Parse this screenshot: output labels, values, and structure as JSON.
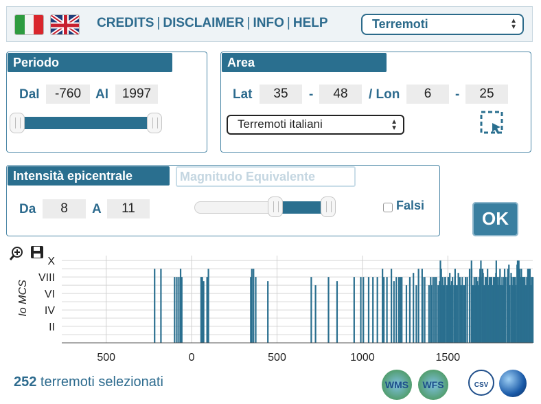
{
  "nav": {
    "flags": [
      "it",
      "en"
    ],
    "links": [
      "CREDITS",
      "DISCLAIMER",
      "INFO",
      "HELP"
    ],
    "layer_select": "Terremoti"
  },
  "periodo": {
    "title": "Periodo",
    "from_label": "Dal",
    "from_value": "-760",
    "to_label": "Al",
    "to_value": "1997"
  },
  "area": {
    "title": "Area",
    "lat_label": "Lat",
    "lat_min": "35",
    "lat_max": "48",
    "lon_label": "/ Lon",
    "lon_min": "6",
    "lon_max": "25",
    "dash": "-",
    "preset": "Terremoti italiani"
  },
  "intensita": {
    "title": "Intensità epicentrale",
    "magnitude_title": "Magnitudo Equivalente",
    "from_label": "Da",
    "from_value": "8",
    "to_label": "A",
    "to_value": "11",
    "slider_from_fraction": 0.58,
    "slider_to_fraction": 1.0,
    "falsi_label": "Falsi",
    "ok_label": "OK"
  },
  "chart_data": {
    "type": "bar",
    "ylabel": "Io MCS",
    "yticks": [
      "II",
      "IV",
      "VI",
      "VIII",
      "X"
    ],
    "ytick_values": [
      3,
      5,
      7,
      9,
      11
    ],
    "xticks": [
      -500,
      0,
      500,
      1000,
      1500
    ],
    "xtick_labels": [
      "500",
      "0",
      "500",
      "1000",
      "1500"
    ],
    "xlim": [
      -760,
      1997
    ],
    "ylim": [
      1,
      11.6
    ],
    "grid": true,
    "color": "#2a6f8f",
    "events": [
      [
        -217,
        10
      ],
      [
        -180,
        10
      ],
      [
        -100,
        9
      ],
      [
        -87,
        9
      ],
      [
        -75,
        9
      ],
      [
        -65,
        10
      ],
      [
        -58,
        9
      ],
      [
        55,
        9
      ],
      [
        62,
        9
      ],
      [
        70,
        8.5
      ],
      [
        90,
        9
      ],
      [
        98,
        10
      ],
      [
        346,
        9
      ],
      [
        352,
        10
      ],
      [
        362,
        10
      ],
      [
        375,
        9
      ],
      [
        446,
        8.5
      ],
      [
        700,
        9
      ],
      [
        725,
        8
      ],
      [
        801,
        9
      ],
      [
        851,
        8.5
      ],
      [
        951,
        9
      ],
      [
        990,
        9
      ],
      [
        1005,
        9
      ],
      [
        1036,
        9
      ],
      [
        1061,
        9
      ],
      [
        1087,
        9
      ],
      [
        1117,
        10
      ],
      [
        1125,
        9
      ],
      [
        1143,
        9
      ],
      [
        1169,
        10
      ],
      [
        1184,
        8.5
      ],
      [
        1198,
        9
      ],
      [
        1213,
        9
      ],
      [
        1222,
        9
      ],
      [
        1230,
        9
      ],
      [
        1257,
        8
      ],
      [
        1277,
        9
      ],
      [
        1298,
        9.5
      ],
      [
        1315,
        8
      ],
      [
        1328,
        10
      ],
      [
        1349,
        10
      ],
      [
        1352,
        9
      ],
      [
        1364,
        9
      ],
      [
        1389,
        8
      ],
      [
        1399,
        9
      ],
      [
        1403,
        8
      ],
      [
        1413,
        9
      ],
      [
        1423,
        9
      ],
      [
        1432,
        9
      ],
      [
        1443,
        8
      ],
      [
        1451,
        8.5
      ],
      [
        1456,
        11
      ],
      [
        1461,
        10
      ],
      [
        1465,
        8
      ],
      [
        1470,
        9
      ],
      [
        1476,
        8
      ],
      [
        1483,
        9
      ],
      [
        1485,
        9
      ],
      [
        1494,
        8
      ],
      [
        1501,
        9
      ],
      [
        1506,
        9
      ],
      [
        1511,
        9.5
      ],
      [
        1517,
        8
      ],
      [
        1522,
        8.5
      ],
      [
        1527,
        9
      ],
      [
        1536,
        8
      ],
      [
        1541,
        9
      ],
      [
        1542,
        10
      ],
      [
        1550,
        8
      ],
      [
        1559,
        8
      ],
      [
        1561,
        9.5
      ],
      [
        1570,
        9
      ],
      [
        1577,
        8
      ],
      [
        1584,
        9
      ],
      [
        1593,
        8
      ],
      [
        1600,
        8
      ],
      [
        1603,
        9
      ],
      [
        1613,
        9
      ],
      [
        1627,
        10
      ],
      [
        1638,
        11
      ],
      [
        1639,
        10
      ],
      [
        1643,
        8
      ],
      [
        1651,
        8
      ],
      [
        1654,
        9
      ],
      [
        1661,
        8
      ],
      [
        1664,
        9
      ],
      [
        1668,
        9
      ],
      [
        1672,
        8.5
      ],
      [
        1679,
        8
      ],
      [
        1683,
        9
      ],
      [
        1688,
        10
      ],
      [
        1693,
        11
      ],
      [
        1694,
        10
      ],
      [
        1702,
        9
      ],
      [
        1703,
        10
      ],
      [
        1706,
        9.5
      ],
      [
        1708,
        8
      ],
      [
        1714,
        8
      ],
      [
        1719,
        9
      ],
      [
        1726,
        9
      ],
      [
        1730,
        9
      ],
      [
        1732,
        10
      ],
      [
        1736,
        8
      ],
      [
        1741,
        8
      ],
      [
        1743,
        9
      ],
      [
        1748,
        8
      ],
      [
        1751,
        9
      ],
      [
        1753,
        8.5
      ],
      [
        1756,
        9
      ],
      [
        1762,
        8
      ],
      [
        1767,
        8
      ],
      [
        1768,
        9
      ],
      [
        1770,
        9
      ],
      [
        1776,
        9
      ],
      [
        1781,
        9.5
      ],
      [
        1783,
        11
      ],
      [
        1786,
        9
      ],
      [
        1789,
        9
      ],
      [
        1791,
        8
      ],
      [
        1794,
        8
      ],
      [
        1799,
        9
      ],
      [
        1802,
        8.5
      ],
      [
        1805,
        10
      ],
      [
        1809,
        8
      ],
      [
        1812,
        8
      ],
      [
        1817,
        9
      ],
      [
        1823,
        8
      ],
      [
        1828,
        9
      ],
      [
        1831,
        8
      ],
      [
        1832,
        10
      ],
      [
        1836,
        9
      ],
      [
        1846,
        9
      ],
      [
        1851,
        10
      ],
      [
        1853,
        8
      ],
      [
        1857,
        10.5
      ],
      [
        1861,
        8
      ],
      [
        1870,
        9.5
      ],
      [
        1873,
        9
      ],
      [
        1877,
        8
      ],
      [
        1883,
        9
      ],
      [
        1887,
        9
      ],
      [
        1894,
        9
      ],
      [
        1895,
        8
      ],
      [
        1897,
        8
      ],
      [
        1905,
        10.5
      ],
      [
        1907,
        9
      ],
      [
        1908,
        11
      ],
      [
        1910,
        8
      ],
      [
        1915,
        11
      ],
      [
        1919,
        9
      ],
      [
        1920,
        10
      ],
      [
        1926,
        8
      ],
      [
        1928,
        9
      ],
      [
        1930,
        10
      ],
      [
        1933,
        9
      ],
      [
        1936,
        9
      ],
      [
        1943,
        9
      ],
      [
        1947,
        9
      ],
      [
        1950,
        9
      ],
      [
        1956,
        8
      ],
      [
        1962,
        9
      ],
      [
        1968,
        10
      ],
      [
        1976,
        10
      ],
      [
        1980,
        10
      ],
      [
        1984,
        8
      ],
      [
        1990,
        9
      ],
      [
        1997,
        9
      ]
    ]
  },
  "toolbar": {
    "zoom_icon": "zoom-in-icon",
    "save_icon": "save-icon"
  },
  "status": {
    "count": "252",
    "text": " terremoti selezionati"
  },
  "services": {
    "wms": "WMS",
    "wfs": "WFS",
    "csv": "CSV"
  }
}
